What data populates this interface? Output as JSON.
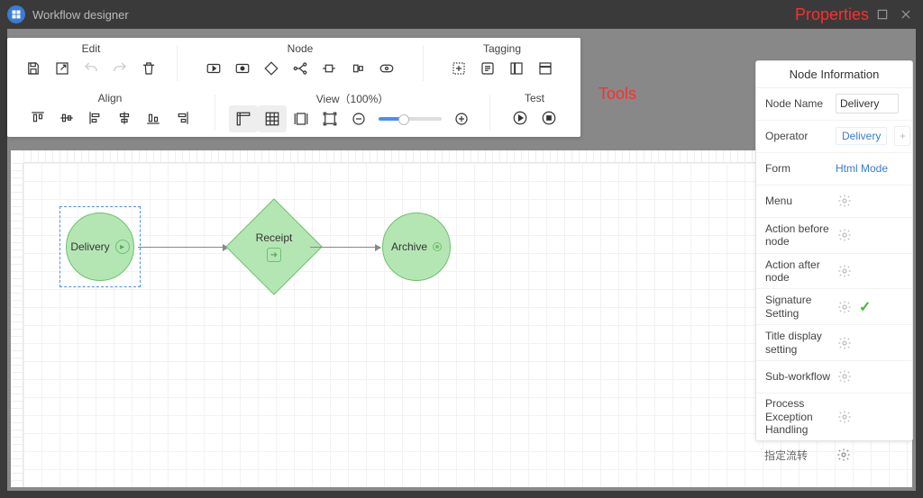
{
  "app": {
    "title": "Workflow designer"
  },
  "annotations": {
    "tools": "Tools",
    "properties": "Properties"
  },
  "toolbar": {
    "edit_label": "Edit",
    "node_label": "Node",
    "tagging_label": "Tagging",
    "align_label": "Align",
    "view_label": "View（100%）",
    "test_label": "Test"
  },
  "nodes": {
    "delivery": "Delivery",
    "receipt": "Receipt",
    "archive": "Archive"
  },
  "properties": {
    "panel_title": "Node Information",
    "node_name_label": "Node Name",
    "node_name_value": "Delivery",
    "operator_label": "Operator",
    "operator_value": "Delivery",
    "form_label": "Form",
    "form_value": "Html Mode",
    "menu_label": "Menu",
    "action_before_label": "Action before node",
    "action_after_label": "Action after node",
    "signature_label": "Signature Setting",
    "title_display_label": "Title display setting",
    "subworkflow_label": "Sub-workflow",
    "exception_label": "Process Exception Handling",
    "stray_label": "指定流转"
  }
}
